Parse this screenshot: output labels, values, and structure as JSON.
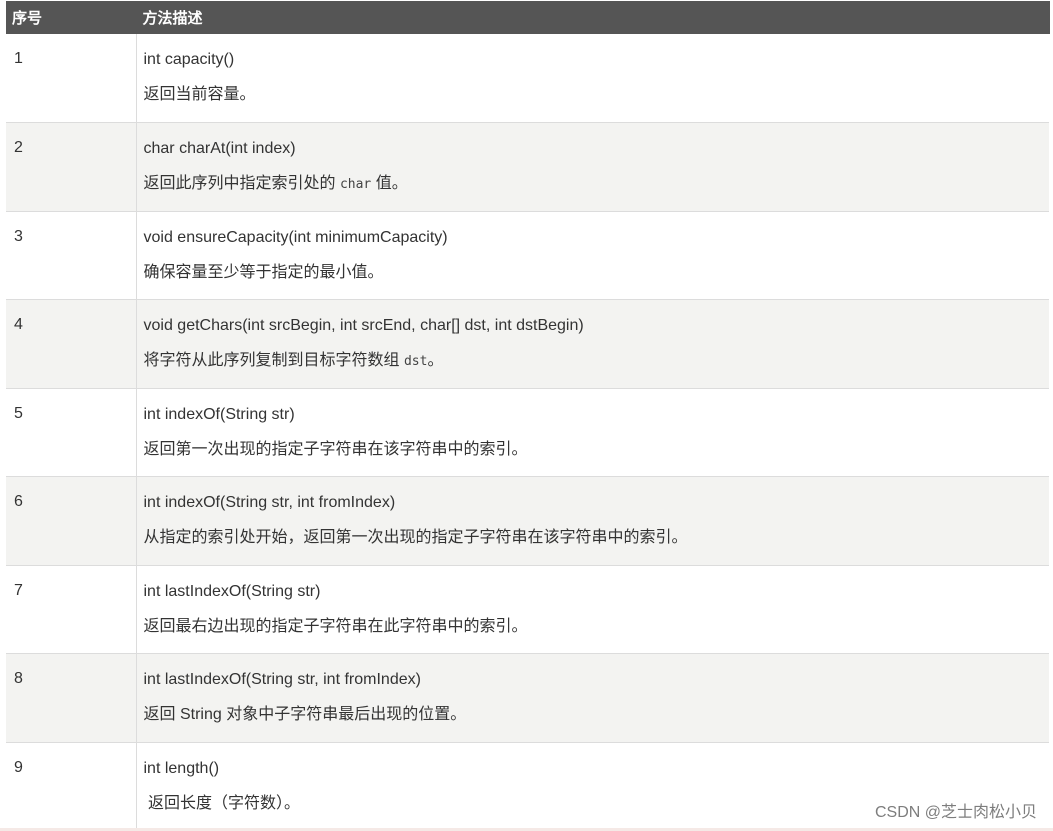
{
  "table": {
    "headers": [
      "序号",
      "方法描述"
    ],
    "rows": [
      {
        "num": "1",
        "signature": "int capacity()",
        "description": [
          {
            "t": "返回当前容量。"
          }
        ]
      },
      {
        "num": "2",
        "signature": "char charAt(int index)",
        "description": [
          {
            "t": "返回此序列中指定索引处的 "
          },
          {
            "t": "char",
            "code": true
          },
          {
            "t": " 值。"
          }
        ]
      },
      {
        "num": "3",
        "signature": "void ensureCapacity(int minimumCapacity)",
        "description": [
          {
            "t": "确保容量至少等于指定的最小值。"
          }
        ]
      },
      {
        "num": "4",
        "signature": "void getChars(int srcBegin, int srcEnd, char[] dst, int dstBegin)",
        "description": [
          {
            "t": "将字符从此序列复制到目标字符数组 "
          },
          {
            "t": "dst",
            "code": true
          },
          {
            "t": "。"
          }
        ]
      },
      {
        "num": "5",
        "signature": "int indexOf(String str)",
        "description": [
          {
            "t": "返回第一次出现的指定子字符串在该字符串中的索引。"
          }
        ]
      },
      {
        "num": "6",
        "signature": "int indexOf(String str, int fromIndex)",
        "description": [
          {
            "t": "从指定的索引处开始，返回第一次出现的指定子字符串在该字符串中的索引。"
          }
        ]
      },
      {
        "num": "7",
        "signature": "int lastIndexOf(String str)",
        "description": [
          {
            "t": "返回最右边出现的指定子字符串在此字符串中的索引。"
          }
        ]
      },
      {
        "num": "8",
        "signature": "int lastIndexOf(String str, int fromIndex)",
        "description": [
          {
            "t": "返回 String 对象中子字符串最后出现的位置。"
          }
        ]
      },
      {
        "num": "9",
        "signature": "int length()",
        "description": [
          {
            "t": " 返回长度（字符数）。"
          }
        ]
      }
    ]
  },
  "watermark": "CSDN @芝士肉松小贝",
  "colors": {
    "header_bg": "#555555",
    "header_text": "#ffffff",
    "alt_row_bg": "#f3f3f1",
    "border": "#dcdcdc",
    "body_text": "#333333"
  }
}
